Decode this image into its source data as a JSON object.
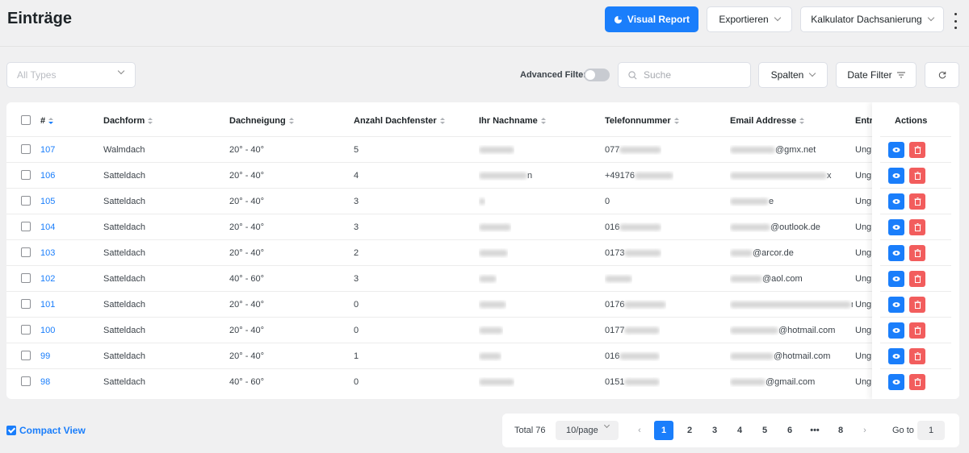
{
  "header": {
    "title": "Einträge",
    "visual_report_label": "Visual Report",
    "export_label": "Exportieren",
    "form_select_label": "Kalkulator Dachsanierung"
  },
  "filters": {
    "types_placeholder": "All Types",
    "advanced_filter_label": "Advanced Filter",
    "advanced_filter_on": false,
    "search_placeholder": "Suche",
    "columns_label": "Spalten",
    "date_filter_label": "Date Filter"
  },
  "table": {
    "columns": [
      "#",
      "Dachform",
      "Dachneigung",
      "Anzahl Dachfenster",
      "Ihr Nachname",
      "Telefonnummer",
      "Email Addresse",
      "Entry"
    ],
    "actions_header": "Actions",
    "rows": [
      {
        "id": "107",
        "dachform": "Walmdach",
        "neigung": "20° - 40°",
        "fenster": "5",
        "name": "",
        "phone": "077",
        "email": "@gmx.net",
        "entry": "Unge"
      },
      {
        "id": "106",
        "dachform": "Satteldach",
        "neigung": "20° - 40°",
        "fenster": "4",
        "name": "n",
        "phone": "+49176",
        "email": "x",
        "entry": "Unge"
      },
      {
        "id": "105",
        "dachform": "Satteldach",
        "neigung": "20° - 40°",
        "fenster": "3",
        "name": "",
        "phone": "0",
        "email": "e",
        "entry": "Unge"
      },
      {
        "id": "104",
        "dachform": "Satteldach",
        "neigung": "20° - 40°",
        "fenster": "3",
        "name": "",
        "phone": "016",
        "email": "@outlook.de",
        "entry": "Unge"
      },
      {
        "id": "103",
        "dachform": "Satteldach",
        "neigung": "20° - 40°",
        "fenster": "2",
        "name": "",
        "phone": "0173",
        "email": "@arcor.de",
        "entry": "Unge"
      },
      {
        "id": "102",
        "dachform": "Satteldach",
        "neigung": "40° - 60°",
        "fenster": "3",
        "name": "",
        "phone": "",
        "email": "@aol.com",
        "entry": "Unge"
      },
      {
        "id": "101",
        "dachform": "Satteldach",
        "neigung": "20° - 40°",
        "fenster": "0",
        "name": "",
        "phone": "0176",
        "email": "r...",
        "entry": "Unge"
      },
      {
        "id": "100",
        "dachform": "Satteldach",
        "neigung": "20° - 40°",
        "fenster": "0",
        "name": "",
        "phone": "0177",
        "email": "@hotmail.com",
        "entry": "Unge"
      },
      {
        "id": "99",
        "dachform": "Satteldach",
        "neigung": "20° - 40°",
        "fenster": "1",
        "name": "",
        "phone": "016",
        "email": "@hotmail.com",
        "entry": "Unge"
      },
      {
        "id": "98",
        "dachform": "Satteldach",
        "neigung": "40° - 60°",
        "fenster": "0",
        "name": "",
        "phone": "0151",
        "email": "@gmail.com",
        "entry": "Unge"
      }
    ]
  },
  "footer": {
    "compact_view_label": "Compact View",
    "total_label": "Total 76",
    "page_size": "10/page",
    "pages": [
      "1",
      "2",
      "3",
      "4",
      "5",
      "6",
      "•••",
      "8"
    ],
    "active_page": "1",
    "goto_label": "Go to",
    "goto_value": "1"
  },
  "colors": {
    "primary": "#1a7efb",
    "danger": "#f25d5d",
    "background": "#f0f0f1"
  }
}
